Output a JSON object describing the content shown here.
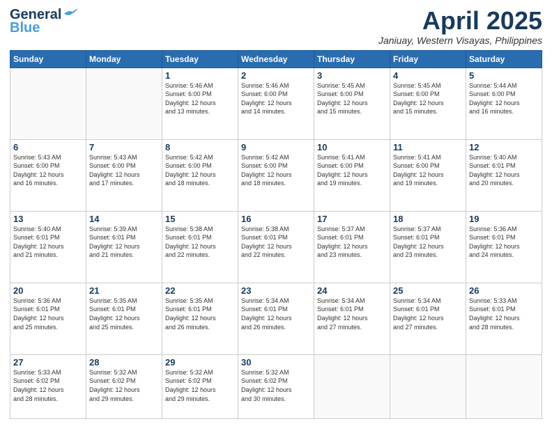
{
  "header": {
    "logo_general": "General",
    "logo_blue": "Blue",
    "month_title": "April 2025",
    "location": "Janiuay, Western Visayas, Philippines"
  },
  "days_of_week": [
    "Sunday",
    "Monday",
    "Tuesday",
    "Wednesday",
    "Thursday",
    "Friday",
    "Saturday"
  ],
  "weeks": [
    [
      {
        "day": "",
        "info": ""
      },
      {
        "day": "",
        "info": ""
      },
      {
        "day": "1",
        "info": "Sunrise: 5:46 AM\nSunset: 6:00 PM\nDaylight: 12 hours\nand 13 minutes."
      },
      {
        "day": "2",
        "info": "Sunrise: 5:46 AM\nSunset: 6:00 PM\nDaylight: 12 hours\nand 14 minutes."
      },
      {
        "day": "3",
        "info": "Sunrise: 5:45 AM\nSunset: 6:00 PM\nDaylight: 12 hours\nand 15 minutes."
      },
      {
        "day": "4",
        "info": "Sunrise: 5:45 AM\nSunset: 6:00 PM\nDaylight: 12 hours\nand 15 minutes."
      },
      {
        "day": "5",
        "info": "Sunrise: 5:44 AM\nSunset: 6:00 PM\nDaylight: 12 hours\nand 16 minutes."
      }
    ],
    [
      {
        "day": "6",
        "info": "Sunrise: 5:43 AM\nSunset: 6:00 PM\nDaylight: 12 hours\nand 16 minutes."
      },
      {
        "day": "7",
        "info": "Sunrise: 5:43 AM\nSunset: 6:00 PM\nDaylight: 12 hours\nand 17 minutes."
      },
      {
        "day": "8",
        "info": "Sunrise: 5:42 AM\nSunset: 6:00 PM\nDaylight: 12 hours\nand 18 minutes."
      },
      {
        "day": "9",
        "info": "Sunrise: 5:42 AM\nSunset: 6:00 PM\nDaylight: 12 hours\nand 18 minutes."
      },
      {
        "day": "10",
        "info": "Sunrise: 5:41 AM\nSunset: 6:00 PM\nDaylight: 12 hours\nand 19 minutes."
      },
      {
        "day": "11",
        "info": "Sunrise: 5:41 AM\nSunset: 6:00 PM\nDaylight: 12 hours\nand 19 minutes."
      },
      {
        "day": "12",
        "info": "Sunrise: 5:40 AM\nSunset: 6:01 PM\nDaylight: 12 hours\nand 20 minutes."
      }
    ],
    [
      {
        "day": "13",
        "info": "Sunrise: 5:40 AM\nSunset: 6:01 PM\nDaylight: 12 hours\nand 21 minutes."
      },
      {
        "day": "14",
        "info": "Sunrise: 5:39 AM\nSunset: 6:01 PM\nDaylight: 12 hours\nand 21 minutes."
      },
      {
        "day": "15",
        "info": "Sunrise: 5:38 AM\nSunset: 6:01 PM\nDaylight: 12 hours\nand 22 minutes."
      },
      {
        "day": "16",
        "info": "Sunrise: 5:38 AM\nSunset: 6:01 PM\nDaylight: 12 hours\nand 22 minutes."
      },
      {
        "day": "17",
        "info": "Sunrise: 5:37 AM\nSunset: 6:01 PM\nDaylight: 12 hours\nand 23 minutes."
      },
      {
        "day": "18",
        "info": "Sunrise: 5:37 AM\nSunset: 6:01 PM\nDaylight: 12 hours\nand 23 minutes."
      },
      {
        "day": "19",
        "info": "Sunrise: 5:36 AM\nSunset: 6:01 PM\nDaylight: 12 hours\nand 24 minutes."
      }
    ],
    [
      {
        "day": "20",
        "info": "Sunrise: 5:36 AM\nSunset: 6:01 PM\nDaylight: 12 hours\nand 25 minutes."
      },
      {
        "day": "21",
        "info": "Sunrise: 5:35 AM\nSunset: 6:01 PM\nDaylight: 12 hours\nand 25 minutes."
      },
      {
        "day": "22",
        "info": "Sunrise: 5:35 AM\nSunset: 6:01 PM\nDaylight: 12 hours\nand 26 minutes."
      },
      {
        "day": "23",
        "info": "Sunrise: 5:34 AM\nSunset: 6:01 PM\nDaylight: 12 hours\nand 26 minutes."
      },
      {
        "day": "24",
        "info": "Sunrise: 5:34 AM\nSunset: 6:01 PM\nDaylight: 12 hours\nand 27 minutes."
      },
      {
        "day": "25",
        "info": "Sunrise: 5:34 AM\nSunset: 6:01 PM\nDaylight: 12 hours\nand 27 minutes."
      },
      {
        "day": "26",
        "info": "Sunrise: 5:33 AM\nSunset: 6:01 PM\nDaylight: 12 hours\nand 28 minutes."
      }
    ],
    [
      {
        "day": "27",
        "info": "Sunrise: 5:33 AM\nSunset: 6:02 PM\nDaylight: 12 hours\nand 28 minutes."
      },
      {
        "day": "28",
        "info": "Sunrise: 5:32 AM\nSunset: 6:02 PM\nDaylight: 12 hours\nand 29 minutes."
      },
      {
        "day": "29",
        "info": "Sunrise: 5:32 AM\nSunset: 6:02 PM\nDaylight: 12 hours\nand 29 minutes."
      },
      {
        "day": "30",
        "info": "Sunrise: 5:32 AM\nSunset: 6:02 PM\nDaylight: 12 hours\nand 30 minutes."
      },
      {
        "day": "",
        "info": ""
      },
      {
        "day": "",
        "info": ""
      },
      {
        "day": "",
        "info": ""
      }
    ]
  ]
}
